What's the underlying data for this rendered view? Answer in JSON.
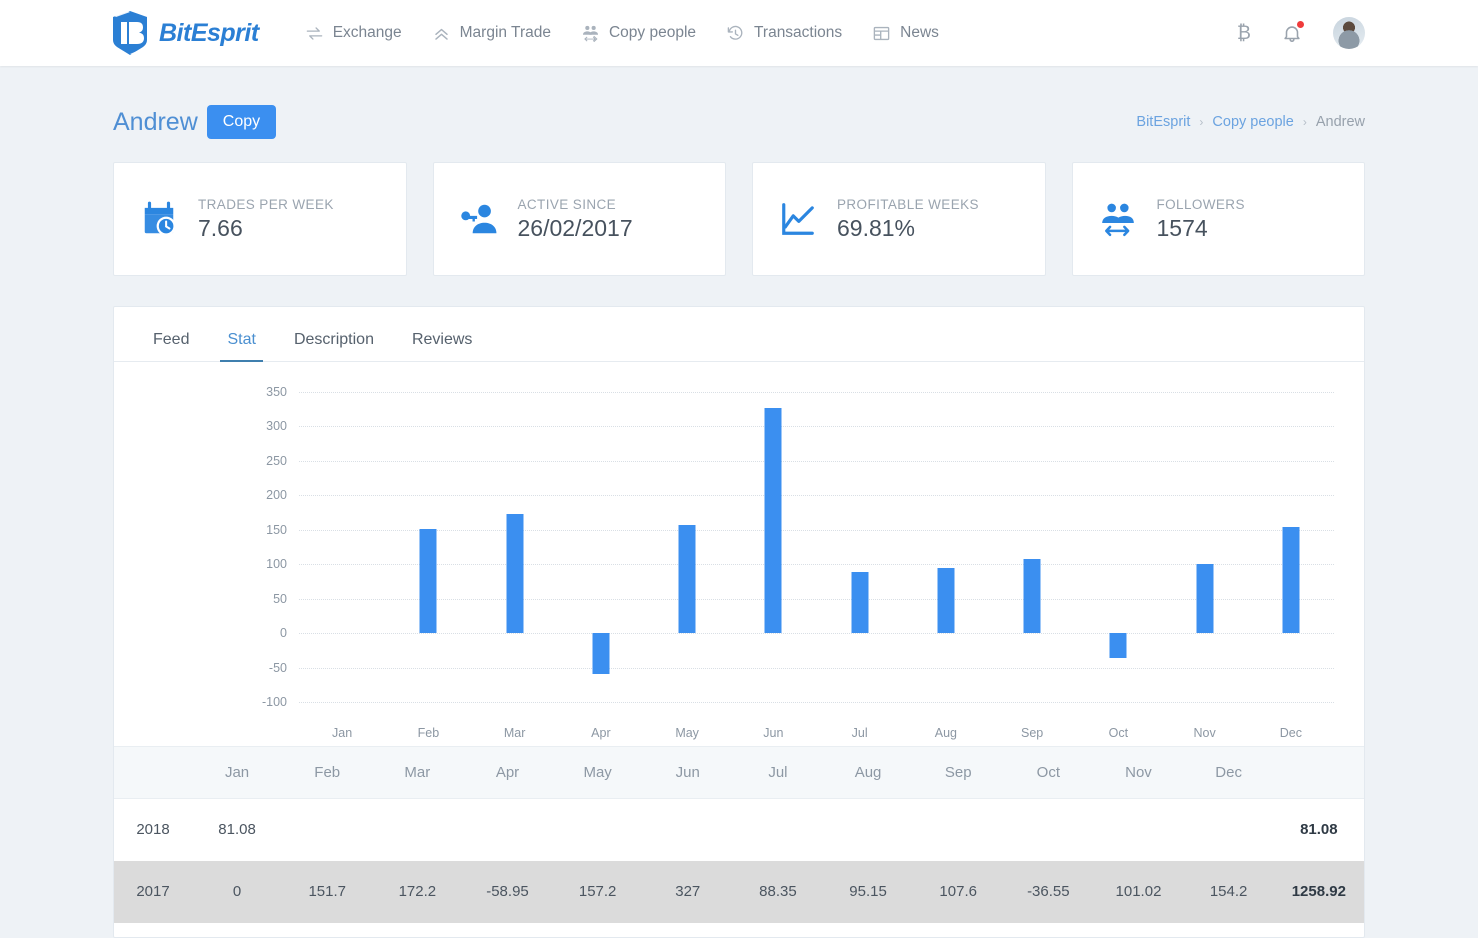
{
  "brand": {
    "name": "BitEsprit",
    "logo_icon": "bitesprit-logo-icon"
  },
  "nav": {
    "items": [
      {
        "label": "Exchange",
        "icon": "exchange-arrows-icon"
      },
      {
        "label": "Margin Trade",
        "icon": "double-chevron-up-icon"
      },
      {
        "label": "Copy people",
        "icon": "copy-people-icon"
      },
      {
        "label": "Transactions",
        "icon": "history-clock-icon"
      },
      {
        "label": "News",
        "icon": "news-grid-icon"
      }
    ],
    "right": {
      "bitcoin_icon": "bitcoin-icon",
      "bitcoin_glyph": "₿",
      "notifications_icon": "bell-icon",
      "has_notification": true,
      "avatar_icon": "user-avatar"
    }
  },
  "profile": {
    "name": "Andrew",
    "copy_label": "Copy"
  },
  "breadcrumb": {
    "items": [
      "BitEsprit",
      "Copy people",
      "Andrew"
    ],
    "separator": "›"
  },
  "cards": [
    {
      "label": "TRADES PER WEEK",
      "value": "7.66",
      "icon": "calendar-clock-icon"
    },
    {
      "label": "ACTIVE SINCE",
      "value": "26/02/2017",
      "icon": "key-user-icon"
    },
    {
      "label": "PROFITABLE WEEKS",
      "value": "69.81%",
      "icon": "line-chart-icon"
    },
    {
      "label": "FOLLOWERS",
      "value": "1574",
      "icon": "followers-icon"
    }
  ],
  "tabs": [
    {
      "label": "Feed",
      "active": false
    },
    {
      "label": "Stat",
      "active": true
    },
    {
      "label": "Description",
      "active": false
    },
    {
      "label": "Reviews",
      "active": false
    }
  ],
  "chart_data": {
    "type": "bar",
    "title": "",
    "xlabel": "",
    "ylabel": "",
    "categories": [
      "Jan",
      "Feb",
      "Mar",
      "Apr",
      "May",
      "Jun",
      "Jul",
      "Aug",
      "Sep",
      "Oct",
      "Nov",
      "Dec"
    ],
    "values": [
      0,
      151.7,
      172.2,
      -58.95,
      157.2,
      327,
      88.35,
      95.15,
      107.6,
      -36.55,
      101.02,
      154.2
    ],
    "series": [
      {
        "name": "2017",
        "values": [
          0,
          151.7,
          172.2,
          -58.95,
          157.2,
          327,
          88.35,
          95.15,
          107.6,
          -36.55,
          101.02,
          154.2
        ]
      }
    ],
    "ylim": [
      -100,
      350
    ],
    "yticks": [
      350,
      300,
      250,
      200,
      150,
      100,
      50,
      0,
      -50,
      -100
    ],
    "ytick_labels": [
      "350",
      "300",
      "250",
      "200",
      "150",
      "100",
      "50",
      "0",
      "-50",
      "-100"
    ],
    "grid": true,
    "legend": "none",
    "bar_color": "#3b8ff0"
  },
  "table": {
    "columns": [
      "",
      "Jan",
      "Feb",
      "Mar",
      "Apr",
      "May",
      "Jun",
      "Jul",
      "Aug",
      "Sep",
      "Oct",
      "Nov",
      "Dec",
      ""
    ],
    "rows": [
      {
        "year": "2018",
        "cells": [
          "81.08",
          "",
          "",
          "",
          "",
          "",
          "",
          "",
          "",
          "",
          "",
          ""
        ],
        "total": "81.08",
        "alt": false
      },
      {
        "year": "2017",
        "cells": [
          "0",
          "151.7",
          "172.2",
          "-58.95",
          "157.2",
          "327",
          "88.35",
          "95.15",
          "107.6",
          "-36.55",
          "101.02",
          "154.2"
        ],
        "total": "1258.92",
        "alt": true
      }
    ]
  },
  "colors": {
    "accent": "#3b8ff0",
    "link": "#6ba3e0",
    "negative": "#ea4a4a",
    "page_bg": "#eef2f6",
    "tab_active": "#4a8fd0"
  }
}
